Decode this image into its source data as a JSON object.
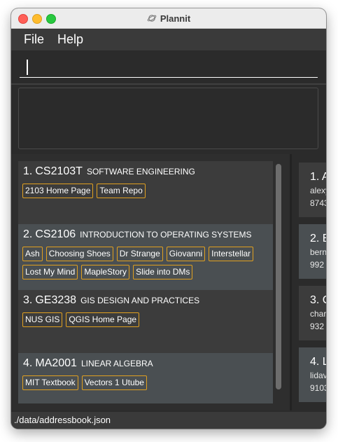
{
  "window": {
    "title": "Plannit",
    "app_icon": "planet-icon",
    "traffic_lights": {
      "close": "#ff5f57",
      "minimize": "#febc2e",
      "maximize": "#28c840"
    }
  },
  "menu": {
    "file": "File",
    "help": "Help"
  },
  "command": {
    "value": "",
    "placeholder": ""
  },
  "result": {
    "text": ""
  },
  "modules": [
    {
      "index": "1.",
      "code": "CS2103T",
      "name": "SOFTWARE ENGINEERING",
      "links": [
        "2103 Home Page",
        "Team Repo"
      ]
    },
    {
      "index": "2.",
      "code": "CS2106",
      "name": "INTRODUCTION TO OPERATING SYSTEMS",
      "links": [
        "Ash",
        "Choosing Shoes",
        "Dr Strange",
        "Giovanni",
        "Interstellar",
        "Lost My Mind",
        "MapleStory",
        "Slide into DMs"
      ]
    },
    {
      "index": "3.",
      "code": "GE3238",
      "name": "GIS DESIGN AND PRACTICES",
      "links": [
        "NUS GIS",
        "QGIS Home Page"
      ]
    },
    {
      "index": "4.",
      "code": "MA2001",
      "name": "LINEAR ALGEBRA",
      "links": [
        "MIT Textbook",
        "Vectors 1 Utube"
      ]
    }
  ],
  "persons": [
    {
      "index": "1.",
      "name": "A",
      "email": "alexy",
      "phone": "8743"
    },
    {
      "index": "2.",
      "name": "B",
      "email": "bern",
      "phone": "992"
    },
    {
      "index": "3.",
      "name": "C",
      "email": "char",
      "phone": "932"
    },
    {
      "index": "4.",
      "name": "L",
      "email": "lidav",
      "phone": "9103"
    }
  ],
  "status": {
    "path": "./data/addressbook.json"
  },
  "colors": {
    "background": "#2b2b2b",
    "card_odd": "#3c3c3c",
    "card_even": "#4a4f52",
    "tag_border": "#e0a020",
    "text": "#ffffff"
  }
}
